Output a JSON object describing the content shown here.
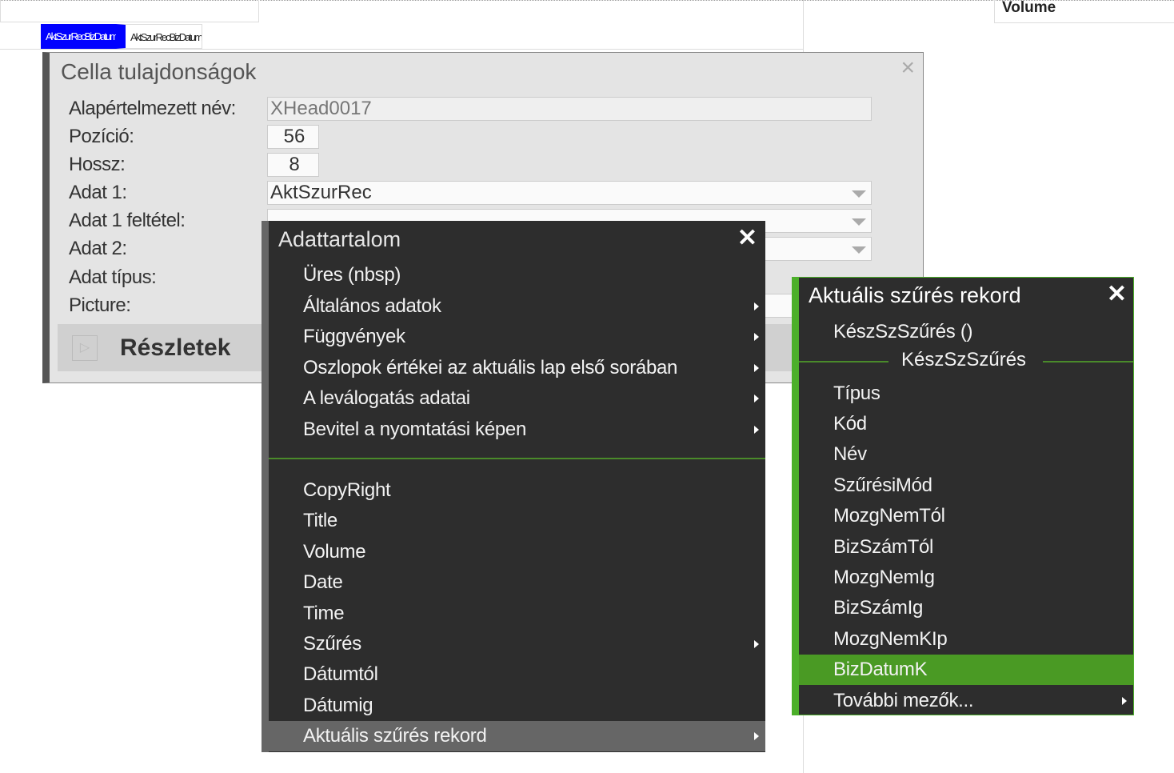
{
  "background": {
    "volume_label": "Volume",
    "tabs": [
      "AktSzurRecBizDatumK",
      "AktSzurRecBizDatumV"
    ]
  },
  "dialog": {
    "title": "Cella tulajdonságok",
    "close": "×",
    "fields": [
      {
        "label": "Alapértelmezett név:",
        "value": "XHead0017"
      },
      {
        "label": "Pozíció:",
        "value": "56"
      },
      {
        "label": "Hossz:",
        "value": "8"
      },
      {
        "label": "Adat 1:",
        "value": "AktSzurRec"
      },
      {
        "label": "Adat 1 feltétel:",
        "value": ""
      },
      {
        "label": "Adat 2:",
        "value": ""
      },
      {
        "label": "Adat típus:"
      },
      {
        "label": "Picture:"
      }
    ],
    "details_label": "Részletek",
    "details_icon": "▷"
  },
  "menu1": {
    "title": "Adattartalom",
    "close": "✕",
    "group1": [
      "Üres (nbsp)",
      "Általános adatok",
      "Függvények",
      "Oszlopok értékei az aktuális lap első sorában",
      "A leválogatás adatai",
      "Bevitel a nyomtatási képen"
    ],
    "group2": [
      "CopyRight",
      "Title",
      "Volume",
      "Date",
      "Time",
      "Szűrés",
      "Dátumtól",
      "Dátumig",
      "Aktuális szűrés rekord"
    ]
  },
  "menu2": {
    "title": "Aktuális szűrés rekord",
    "close": "✕",
    "top_item": "KészSzSzűrés ()",
    "section": "KészSzSzűrés",
    "items": [
      "Típus",
      "Kód",
      "Név",
      "SzűrésiMód",
      "MozgNemTól",
      "BizSzámTól",
      "MozgNemIg",
      "BizSzámIg",
      "MozgNemKIp",
      "BizDatumK",
      "További mezők..."
    ]
  },
  "colors": {
    "accent_green": "#4caf2a",
    "highlight": "#4a9a24",
    "tab_blue": "#0000ff"
  }
}
